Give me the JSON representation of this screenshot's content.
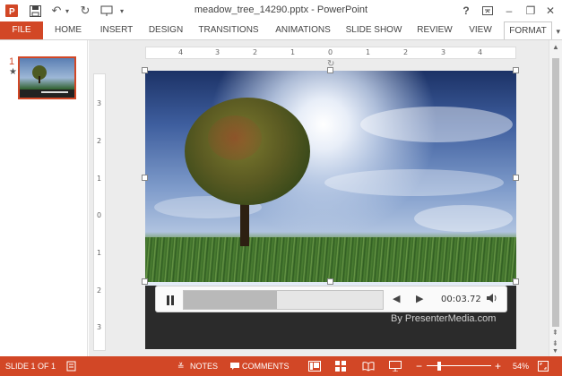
{
  "window": {
    "title": "meadow_tree_14290.pptx - PowerPoint",
    "help": "?"
  },
  "ribbon": {
    "tabs": [
      "FILE",
      "HOME",
      "INSERT",
      "DESIGN",
      "TRANSITIONS",
      "ANIMATIONS",
      "SLIDE SHOW",
      "REVIEW",
      "VIEW",
      "FORMAT"
    ],
    "active_tab": "FORMAT"
  },
  "thumbnails": {
    "slide_number": "1",
    "marker": "★"
  },
  "rulers": {
    "horizontal": [
      "4",
      "3",
      "2",
      "1",
      "0",
      "1",
      "2",
      "3",
      "4"
    ],
    "vertical": [
      "3",
      "2",
      "1",
      "0",
      "1",
      "2",
      "3"
    ]
  },
  "slide": {
    "credit": "By PresenterMedia.com"
  },
  "media": {
    "time": "00:03.72",
    "progress": 0.47
  },
  "statusbar": {
    "slide_info": "SLIDE 1 OF 1",
    "notes": "NOTES",
    "comments": "COMMENTS",
    "zoom": "54%"
  },
  "colors": {
    "accent": "#d24726"
  }
}
